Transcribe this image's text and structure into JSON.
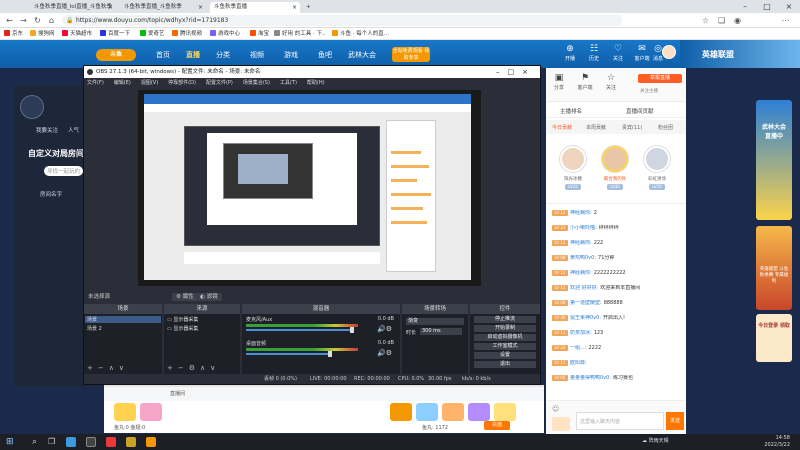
{
  "browser": {
    "tabs": [
      {
        "label": "斗鱼秋季直播_lol直播_斗鱼秋季"
      },
      {
        "label": "斗鱼秋季直播_斗鱼秋季"
      },
      {
        "label": "斗鱼秋季直播"
      }
    ],
    "url": "https://www.douyu.com/topic/wdhyx?rid=1719183",
    "bookmarks": [
      "京东",
      "搜狗网",
      "天猫超市",
      "百度一下",
      "爱奇艺",
      "腾讯视频",
      "游戏中心",
      "淘宝",
      "好用 的工具 · 下..",
      "斗鱼 · 每个人的直..."
    ]
  },
  "site": {
    "logo": "斗鱼",
    "nav": [
      "首页",
      "直播",
      "分类",
      "视频",
      "游戏",
      "鱼吧",
      "武林大会"
    ],
    "download_btn": "全站免费观看 领取专享",
    "header_icons": [
      {
        "glyph": "⊕",
        "label": "开播"
      },
      {
        "glyph": "☷",
        "label": "历史"
      },
      {
        "glyph": "♡",
        "label": "关注"
      },
      {
        "glyph": "✉",
        "label": "客户端"
      },
      {
        "glyph": "◎",
        "label": "消息"
      }
    ],
    "banner_text": "英雄联盟"
  },
  "left": {
    "tabs": [
      "我要关注",
      "人气"
    ],
    "title": "自定义对局房间",
    "search_placeholder": "寻找一起玩的",
    "room_label": "房间名字"
  },
  "obs": {
    "title": "OBS 27.1.3 (64-bit, windows) - 配置文件: 未命名 - 场景: 未命名",
    "menu": [
      "文件(F)",
      "编辑(E)",
      "视图(V)",
      "停靠部件(D)",
      "配置文件(P)",
      "场景集合(S)",
      "工具(T)",
      "帮助(H)"
    ],
    "bar": {
      "label": "未选择源",
      "props": "属性",
      "filters": "滤镜"
    },
    "scenes": {
      "header": "场景",
      "items": [
        "场景",
        "场景 2"
      ]
    },
    "sources": {
      "header": "来源",
      "items": [
        "显示器采集",
        "显示器采集"
      ]
    },
    "mixer": {
      "header": "混音器",
      "channels": [
        {
          "name": "麦克风/Aux",
          "db": "0.0 dB",
          "level": 0.95
        },
        {
          "name": "桌面音频",
          "db": "0.0 dB",
          "level": 0.75
        }
      ]
    },
    "transitions": {
      "header": "场景转场",
      "type": "渐变",
      "duration_label": "时长",
      "duration": "300 ms"
    },
    "controls": {
      "header": "控件",
      "buttons": [
        "停止推流",
        "开始录制",
        "启动虚拟摄像机",
        "工作室模式",
        "设置",
        "退出"
      ]
    },
    "status": {
      "dropped": "丢帧 0 (0.0%)",
      "live": "LIVE: 00:00:00",
      "rec": "REC: 00:00:00",
      "cpu": "CPU: 0.0%",
      "fps": "30.00 fps",
      "kbps": "kb/s: 0 kb/s"
    }
  },
  "giftbar": {
    "user": "鱼丸:0  鱼翅:0",
    "stream_label": "直播间",
    "balance": "鱼丸: 1172",
    "recharge": "充值"
  },
  "right": {
    "top_icons": [
      {
        "glyph": "▣",
        "label": "分享"
      },
      {
        "glyph": "⚑",
        "label": "客户端"
      },
      {
        "glyph": "☆",
        "label": "关注"
      }
    ],
    "report_btn": "举报直播",
    "follow_text": "关注主播",
    "ranking": [
      "主播排名",
      "直播间贡献"
    ],
    "tabs": [
      "今日贡献",
      "本周贡献",
      "贵宾(11)",
      "粉丝团"
    ],
    "top3": [
      {
        "name": "阳光冰糖",
        "level": "LV32"
      },
      {
        "name": "最合我的秋",
        "level": "LV40"
      },
      {
        "name": "彩虹弹涂",
        "level": "LV35"
      }
    ],
    "chat": [
      {
        "lv": "LV 12",
        "user": "神经病你:",
        "text": "2"
      },
      {
        "lv": "LV 21",
        "user": "小小哪吒喵:",
        "text": "绊绊绊绊"
      },
      {
        "lv": "LV 13",
        "user": "神经病你:",
        "text": "222"
      },
      {
        "lv": "LV 08",
        "user": "黄鸡鸭0v0:",
        "text": "71分钟"
      },
      {
        "lv": "LV 12",
        "user": "神经病你:",
        "text": "2222222222"
      },
      {
        "lv": "LV 15",
        "user": "欢迎 好好好:",
        "text": "欢迎来到本直播间"
      },
      {
        "lv": "LV 09",
        "user": "第一道壁暖壁:",
        "text": "888888"
      },
      {
        "lv": "LV 30",
        "user": "鼠王果神0v0:",
        "text": "开启出入!"
      },
      {
        "lv": "LV 11",
        "user": "奶茶加冰:",
        "text": "123"
      },
      {
        "lv": "LV 22",
        "user": "一组...:",
        "text": "2222"
      },
      {
        "lv": "LV 17",
        "user": "欧阳菲:",
        "text": ""
      },
      {
        "lv": "LV 05",
        "user": "量量量得鸭鸭0v0:",
        "text": "练习赛也"
      }
    ],
    "chat_placeholder": "这里输入聊天内容",
    "send": "发送"
  },
  "ads": {
    "ad1": "武林大会 直播中",
    "ad2": "英雄联盟 斗鱼秋季赛 专属福利",
    "ad3": "今日登录 领取"
  },
  "taskbar": {
    "weather": "阵雨天晴",
    "time": "14:58",
    "date": "2022/3/22"
  }
}
